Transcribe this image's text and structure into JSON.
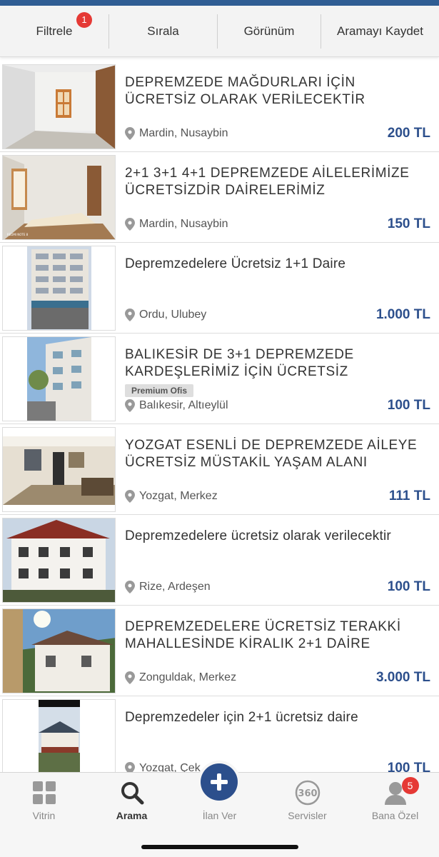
{
  "toolbar": {
    "filter_label": "Filtrele",
    "filter_badge": "1",
    "sort_label": "Sırala",
    "view_label": "Görünüm",
    "save_search_label": "Aramayı Kaydet"
  },
  "listings": [
    {
      "title": "DEPREMZEDE MAĞDURLARI İÇİN ÜCRETSİZ OLARAK VERİLECEKTİR",
      "location": "Mardin, Nusaybin",
      "price": "200 TL"
    },
    {
      "title": "2+1 3+1 4+1 DEPREMZEDE AİLELERİMİZE ÜCRETSİZDİR DAİRELERİMİZ",
      "location": "Mardin, Nusaybin",
      "price": "150 TL"
    },
    {
      "title": "Depremzedelere Ücretsiz 1+1 Daire",
      "location": "Ordu, Ulubey",
      "price": "1.000 TL"
    },
    {
      "title": "BALIKESİR DE 3+1 DEPREMZEDE KARDEŞLERİMİZ İÇİN ÜCRETSİZ",
      "badge": "Premium Ofis",
      "location": "Balıkesir, Altıeylül",
      "price": "100 TL"
    },
    {
      "title": "YOZGAT ESENLİ DE DEPREMZEDE AİLEYE ÜCRETSİZ MÜSTAKİL YAŞAM ALANI",
      "location": "Yozgat, Merkez",
      "price": "111 TL"
    },
    {
      "title": "Depremzedelere ücretsiz olarak verilecektir",
      "location": "Rize, Ardeşen",
      "price": "100 TL"
    },
    {
      "title": "DEPREMZEDELERE ÜCRETSİZ TERAKKİ MAHALLESİNDE KİRALIK 2+1 DAİRE",
      "location": "Zonguldak, Merkez",
      "price": "3.000 TL"
    },
    {
      "title": "Depremzedeler için 2+1 ücretsiz daire",
      "location": "Yozgat, Çek...",
      "price": "100 TL"
    }
  ],
  "tabbar": {
    "vitrin": "Vitrin",
    "arama": "Arama",
    "ilan_ver": "İlan Ver",
    "servisler": "Servisler",
    "bana_ozel": "Bana Özel",
    "bana_ozel_badge": "5",
    "icon_360": "360"
  },
  "colors": {
    "brand": "#2c4f8c",
    "topbar": "#2f5d93",
    "badge": "#e53935"
  }
}
